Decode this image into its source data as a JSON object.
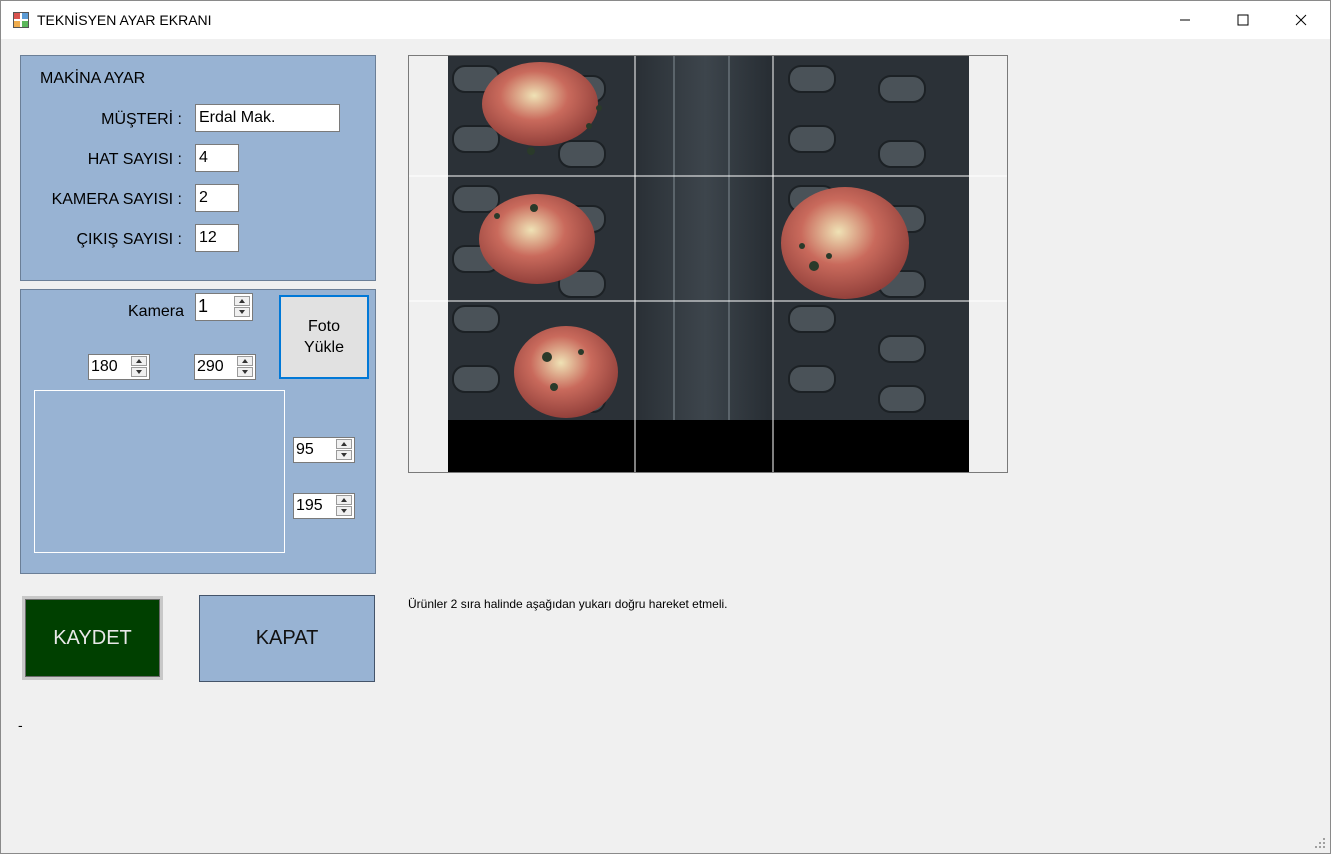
{
  "window": {
    "title": "TEKNİSYEN AYAR EKRANI",
    "icons": {
      "app": "app-icon",
      "minimize": "minimize-icon",
      "maximize": "maximize-icon",
      "close": "close-icon"
    }
  },
  "machine_settings": {
    "heading": "MAKİNA AYAR",
    "customer_label": "MÜŞTERİ :",
    "customer_value": "Erdal Mak.",
    "line_count_label": "HAT SAYISI :",
    "line_count_value": "4",
    "camera_count_label": "KAMERA SAYISI :",
    "camera_count_value": "2",
    "output_count_label": "ÇIKIŞ SAYISI :",
    "output_count_value": "12"
  },
  "camera_settings": {
    "camera_label": "Kamera",
    "camera_value": "1",
    "x_value": "180",
    "y_value": "290",
    "width_value": "95",
    "height_value": "195",
    "load_photo_label": "Foto Yükle"
  },
  "actions": {
    "save_label": "KAYDET",
    "close_label": "KAPAT"
  },
  "info_text": "Ürünler 2 sıra halinde aşağıdan yukarı doğru hareket etmeli.",
  "footer_text": "-",
  "colors": {
    "panel": "#98b3d3",
    "save_button": "#004000",
    "close_button": "#98b3d3",
    "focus_border": "#0078d7"
  }
}
